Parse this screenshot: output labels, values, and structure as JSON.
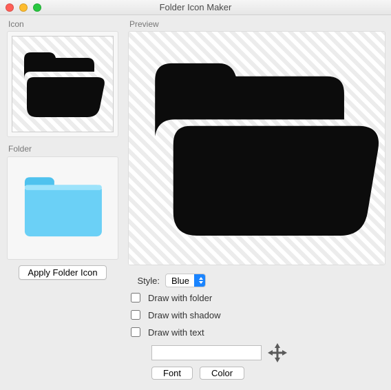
{
  "window": {
    "title": "Folder Icon Maker"
  },
  "labels": {
    "icon": "Icon",
    "folder": "Folder",
    "preview": "Preview",
    "apply_folder_icon": "Apply Folder Icon",
    "style": "Style:",
    "draw_with_folder": "Draw with folder",
    "draw_with_shadow": "Draw with shadow",
    "draw_with_text": "Draw with text",
    "font": "Font",
    "color": "Color"
  },
  "controls": {
    "style_selected": "Blue",
    "draw_with_folder": false,
    "draw_with_shadow": false,
    "draw_with_text": false,
    "text_value": ""
  },
  "colors": {
    "folder_blue": "#6bd0f6",
    "folder_blue_dark": "#4fc2ee",
    "icon_black": "#0c0c0c",
    "accent": "#1a84ff"
  }
}
